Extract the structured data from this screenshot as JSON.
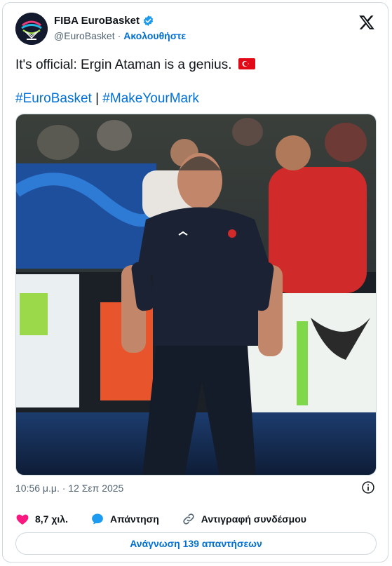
{
  "author": {
    "name": "FIBA EuroBasket",
    "handle": "@EuroBasket",
    "separator": "·",
    "follow_label": "Ακολουθήστε",
    "avatar_icon": "fiba-eurobasket-logo-icon",
    "verified_icon": "verified-badge-icon"
  },
  "tweet": {
    "text": "It's official: Ergin Ataman is a genius.",
    "flag_icon": "turkey-flag-icon",
    "hashtag1": "#EuroBasket",
    "divider": "|",
    "hashtag2": "#MakeYourMark"
  },
  "meta": {
    "time": "10:56 μ.μ.",
    "separator": "·",
    "date": "12 Σεπ 2025"
  },
  "actions": {
    "likes": "8,7 χιλ.",
    "reply_label": "Απάντηση",
    "copy_link_label": "Αντιγραφή συνδέσμου"
  },
  "read_replies_label": "Ανάγνωση 139 απαντήσεων",
  "colors": {
    "link": "#006fd6",
    "like": "#f91880",
    "reply_bubble": "#1d9bf0",
    "text": "#0f1419",
    "muted": "#536471"
  }
}
